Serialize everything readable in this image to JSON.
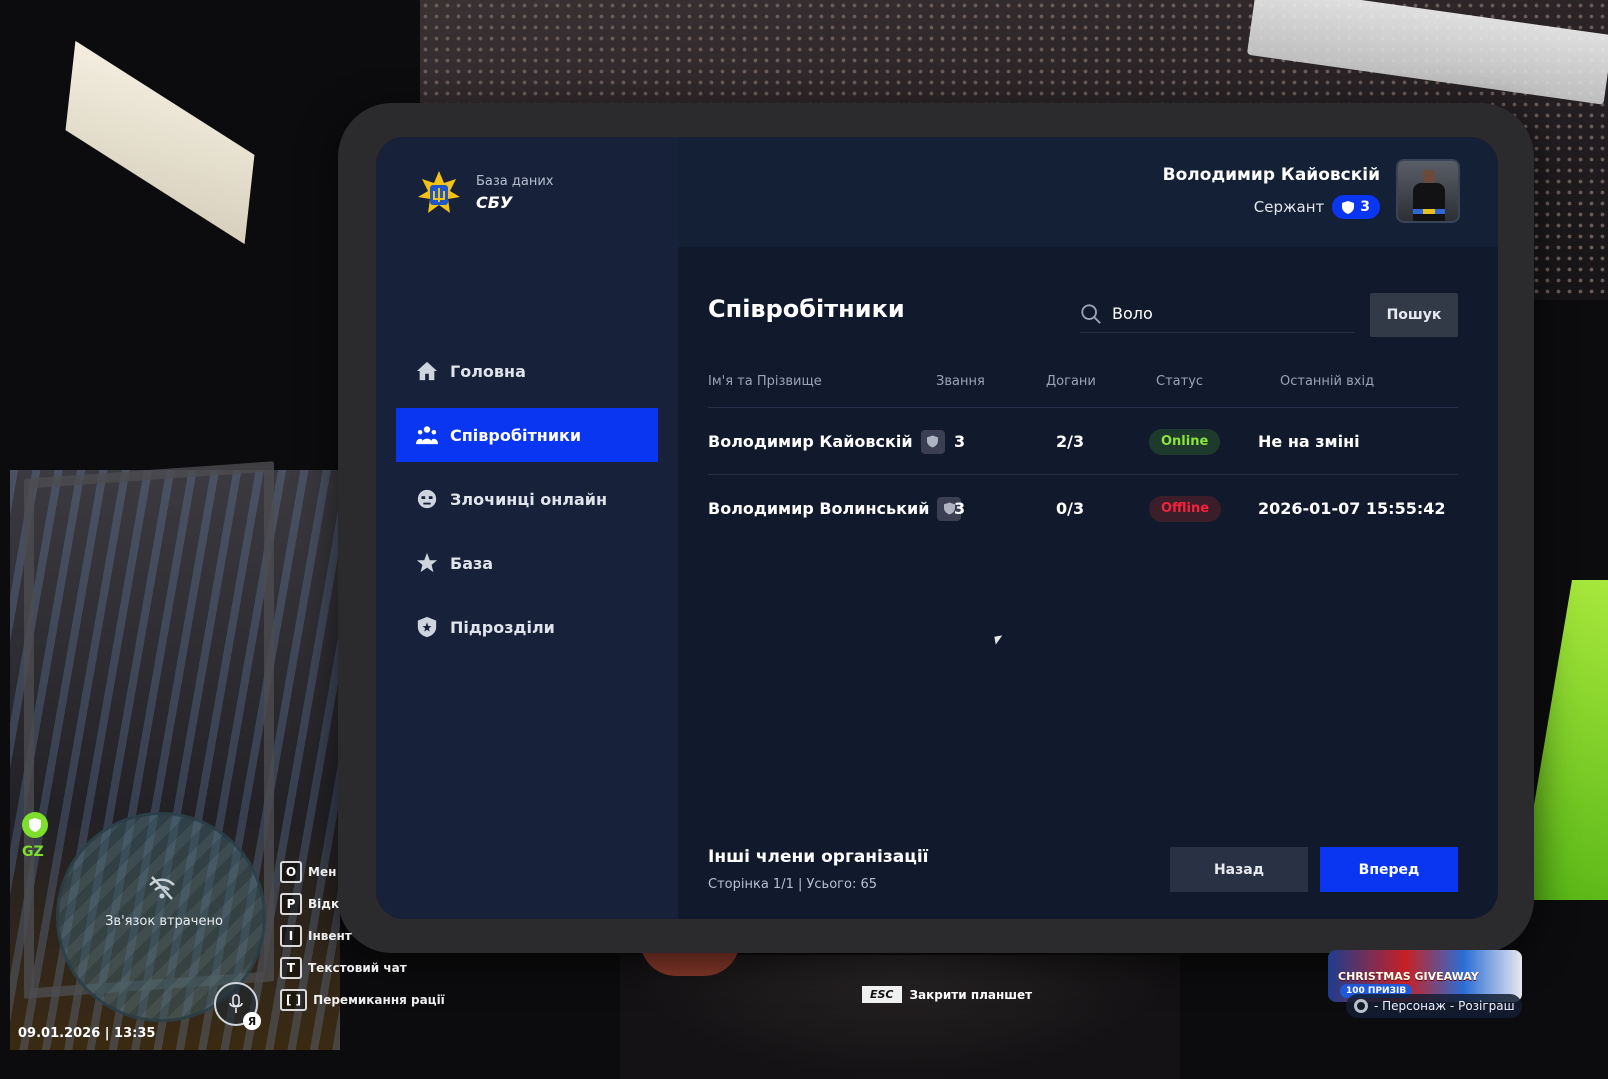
{
  "app": {
    "logo_sub": "База даних",
    "logo_main": "СБУ"
  },
  "user": {
    "name": "Володимир Кайовскій",
    "rank": "Сержант",
    "rank_level": "3"
  },
  "nav": {
    "items": [
      {
        "label": "Головна",
        "icon": "home-icon",
        "active": false
      },
      {
        "label": "Співробітники",
        "icon": "users-icon",
        "active": true
      },
      {
        "label": "Злочинці онлайн",
        "icon": "criminal-icon",
        "active": false
      },
      {
        "label": "База",
        "icon": "star-icon",
        "active": false
      },
      {
        "label": "Підрозділи",
        "icon": "shield-icon",
        "active": false
      }
    ]
  },
  "main": {
    "title": "Співробітники",
    "search_value": "Воло",
    "search_button": "Пошук",
    "columns": [
      "Ім'я та Прізвище",
      "Звання",
      "Догани",
      "Статус",
      "Останній вхід"
    ],
    "rows": [
      {
        "name": "Володимир Кайовскій",
        "rank": "3",
        "reprimands": "2/3",
        "status": "Online",
        "last_login": "Не на зміні"
      },
      {
        "name": "Володимир Волинський",
        "rank": "3",
        "reprimands": "0/3",
        "status": "Offline",
        "last_login": "2026-01-07 15:55:42"
      }
    ],
    "footer_title": "Інші члени організації",
    "footer_info": "Сторінка 1/1 | Усього: 65",
    "back_button": "Назад",
    "next_button": "Вперед"
  },
  "hud": {
    "zone": "GZ",
    "radar_status": "Зв'язок втрачено",
    "mic_badge": "Я",
    "datetime": "09.01.2026 | 13:35",
    "keys": [
      {
        "key": "O",
        "label": "Мен"
      },
      {
        "key": "P",
        "label": "Відк"
      },
      {
        "key": "I",
        "label": "Інвент"
      },
      {
        "key": "T",
        "label": "Текстовий чат"
      },
      {
        "key": "[ ]",
        "label": "Перемикання рації"
      }
    ],
    "esc_key": "ESC",
    "esc_label": "Закрити планшет",
    "promo_title": "CHRISTMAS GIVEAWAY",
    "promo_sub": "100 ПРИЗІВ",
    "promo_bar": "- Персонаж - Розіграш"
  },
  "colors": {
    "accent": "#0a36f2",
    "online": "#8be33c",
    "offline": "#f2233a"
  }
}
